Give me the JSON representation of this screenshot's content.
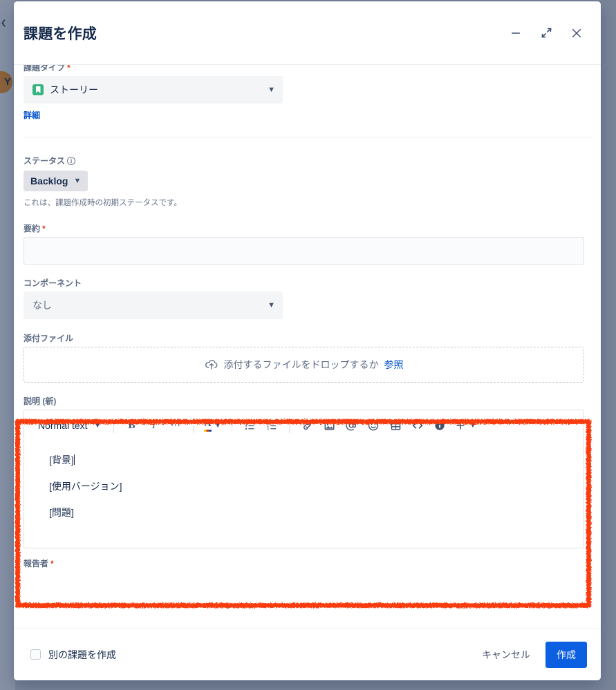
{
  "background": {
    "avatar_initial": "Y"
  },
  "modal": {
    "title": "課題を作成",
    "header_actions": [
      {
        "name": "minimize",
        "label": "最小化"
      },
      {
        "name": "collapse",
        "label": "縮小"
      },
      {
        "name": "close",
        "label": "閉じる"
      }
    ],
    "fields": {
      "issue_type": {
        "label": "課題タイプ",
        "required": true,
        "value": "ストーリー",
        "icon": "story-icon",
        "details_link": "詳細"
      },
      "status": {
        "label": "ステータス",
        "required": false,
        "info_icon": "info-icon",
        "value": "Backlog",
        "helper_text": "これは、課題作成時の初期ステータスです。"
      },
      "summary": {
        "label": "要約",
        "required": true,
        "value": "",
        "placeholder": ""
      },
      "components": {
        "label": "コンポーネント",
        "required": false,
        "value": "なし"
      },
      "attachment": {
        "label": "添付ファイル",
        "required": false,
        "dropzone_text": "添付するファイルをドロップするか",
        "browse_link": "参照",
        "icon": "cloud-upload-icon"
      },
      "description": {
        "label": "説明 (新)",
        "required": false,
        "toolbar": {
          "block_type": "Normal text",
          "buttons": [
            {
              "name": "bold",
              "glyph": "B"
            },
            {
              "name": "italic",
              "glyph": "I"
            },
            {
              "name": "more-formatting",
              "glyph": "•••"
            },
            {
              "name": "text-color",
              "glyph": "A"
            },
            {
              "name": "bulleted-list",
              "glyph": "bullet-list-icon"
            },
            {
              "name": "numbered-list",
              "glyph": "numbered-list-icon"
            },
            {
              "name": "link",
              "glyph": "link-icon"
            },
            {
              "name": "image",
              "glyph": "image-icon"
            },
            {
              "name": "mention",
              "glyph": "@"
            },
            {
              "name": "emoji",
              "glyph": "emoji-icon"
            },
            {
              "name": "table",
              "glyph": "table-icon"
            },
            {
              "name": "code",
              "glyph": "<>"
            },
            {
              "name": "info-panel",
              "glyph": "info-filled-icon"
            },
            {
              "name": "insert-more",
              "glyph": "+"
            }
          ]
        },
        "content_lines": [
          "[背景]",
          "[使用バージョン]",
          "[問題]"
        ]
      },
      "reporter": {
        "label": "報告者",
        "required": true
      }
    },
    "footer": {
      "create_another_label": "別の課題を作成",
      "create_another_checked": false,
      "cancel_label": "キャンセル",
      "create_label": "作成"
    }
  },
  "annotation": {
    "color": "#f93b0c",
    "target": "説明 (新)"
  }
}
